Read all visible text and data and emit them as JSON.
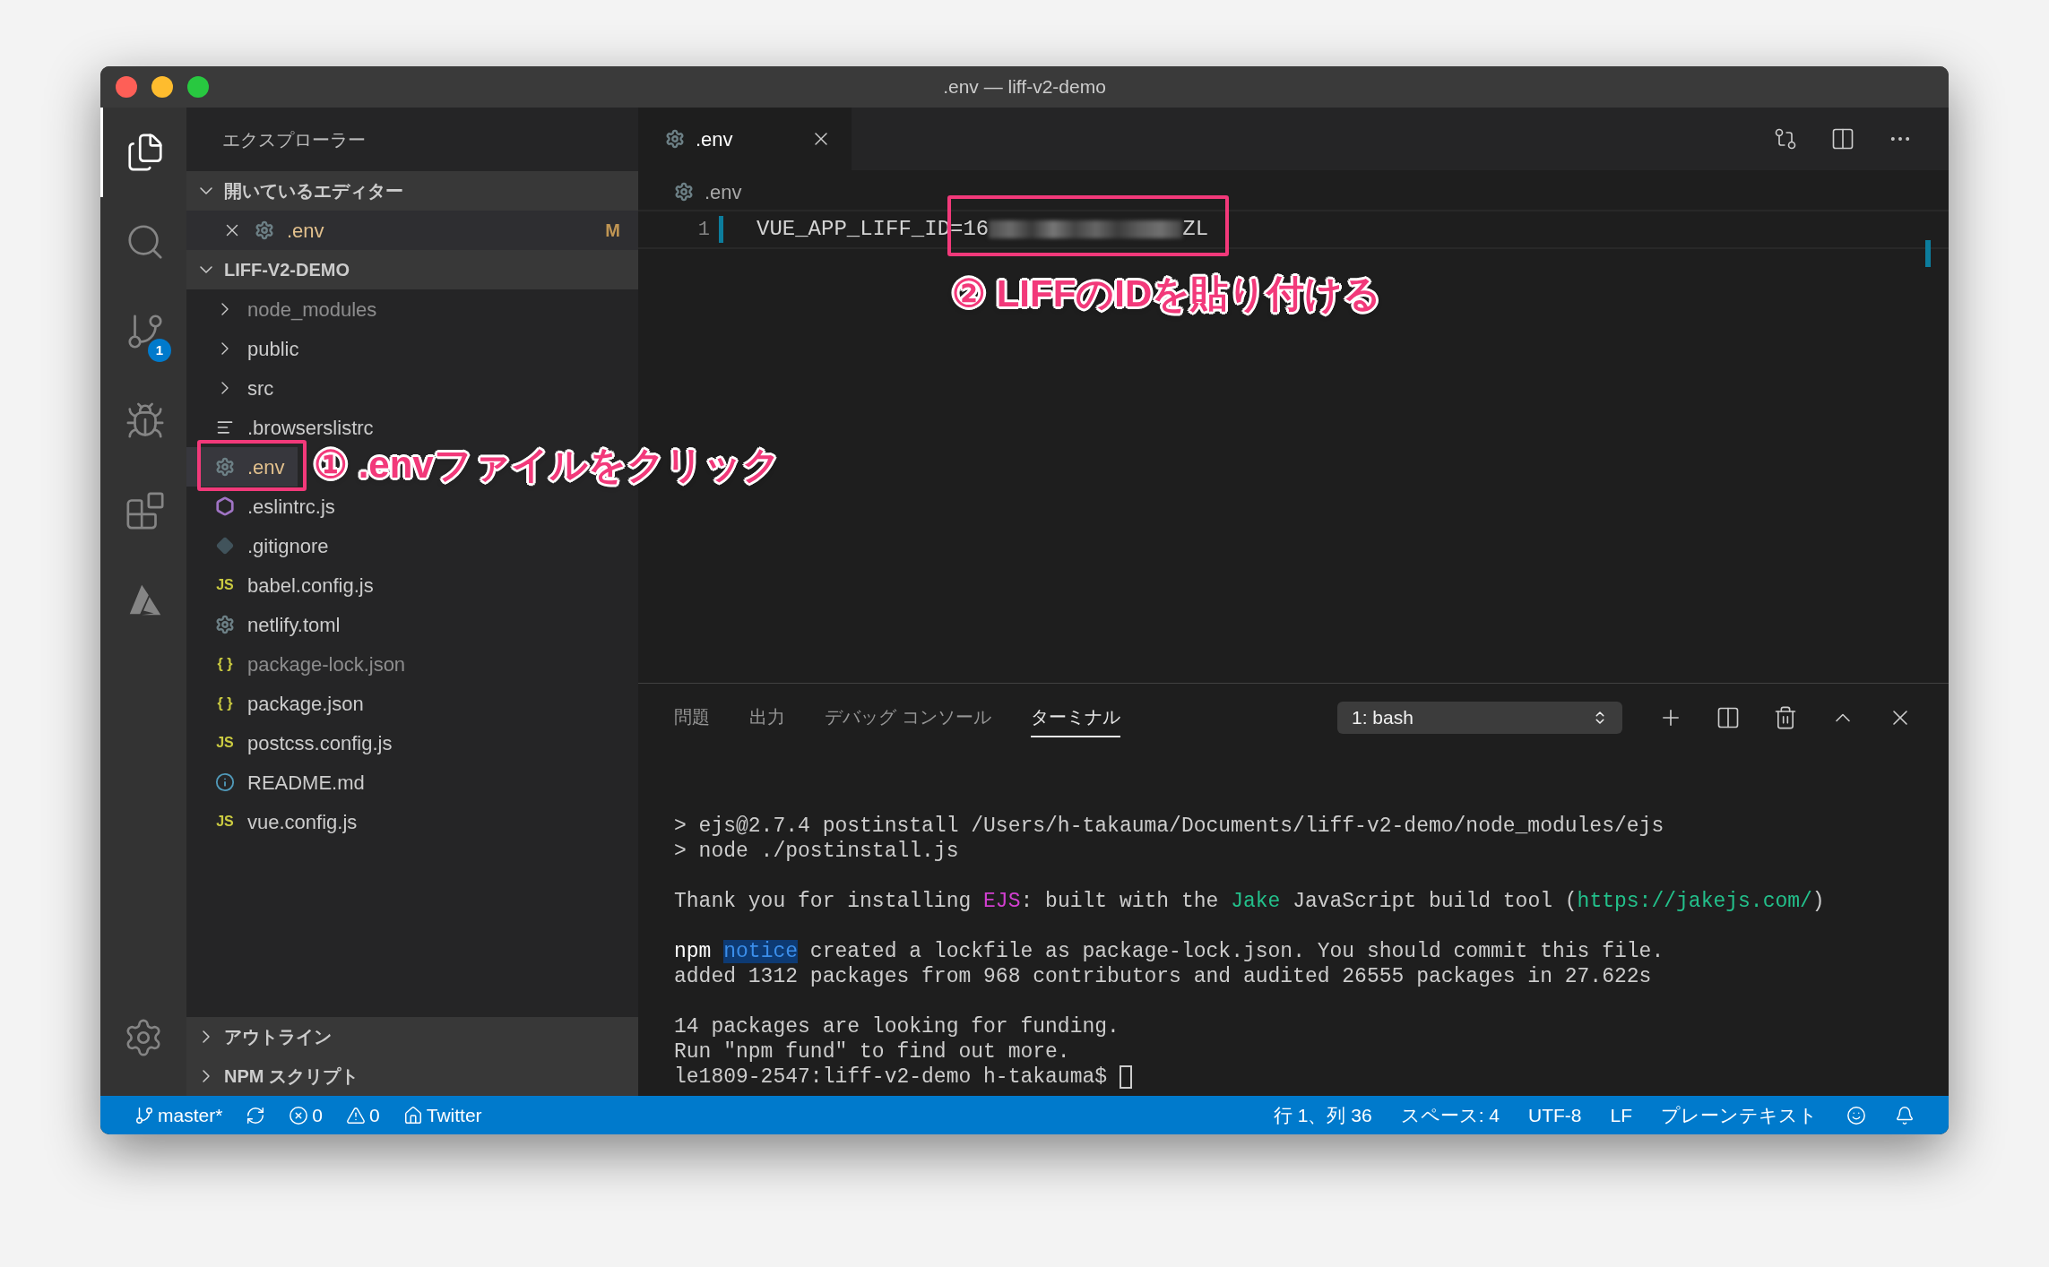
{
  "window": {
    "title": ".env — liff-v2-demo"
  },
  "activity_bar": {
    "items": [
      {
        "kind": "files",
        "selected": true
      },
      {
        "kind": "search",
        "selected": false
      },
      {
        "kind": "source-control",
        "selected": false,
        "badge": "1"
      },
      {
        "kind": "debug",
        "selected": false
      },
      {
        "kind": "extensions",
        "selected": false
      },
      {
        "kind": "azure",
        "selected": false
      }
    ],
    "bottom_items": [
      {
        "kind": "settings"
      }
    ]
  },
  "sidebar": {
    "title": "エクスプローラー",
    "open_editors": {
      "title": "開いているエディター",
      "expanded": true,
      "items": [
        {
          "name": ".env",
          "kind": "config",
          "modified": true,
          "badge": "M"
        }
      ]
    },
    "project": {
      "title": "LIFF-V2-DEMO",
      "expanded": true,
      "items": [
        {
          "name": "node_modules",
          "kind": "folder",
          "expanded": false,
          "dimmed": true,
          "modified": false,
          "selected": false
        },
        {
          "name": "public",
          "kind": "folder",
          "expanded": false,
          "dimmed": false,
          "modified": false,
          "selected": false
        },
        {
          "name": "src",
          "kind": "folder",
          "expanded": false,
          "dimmed": false,
          "modified": false,
          "selected": false
        },
        {
          "name": ".browserslistrc",
          "kind": "text",
          "dimmed": false,
          "modified": false,
          "selected": false
        },
        {
          "name": ".env",
          "kind": "config",
          "dimmed": false,
          "modified": true,
          "selected": true
        },
        {
          "name": ".eslintrc.js",
          "kind": "eslint",
          "dimmed": false,
          "modified": false,
          "selected": false
        },
        {
          "name": ".gitignore",
          "kind": "git",
          "dimmed": false,
          "modified": false,
          "selected": false
        },
        {
          "name": "babel.config.js",
          "kind": "script",
          "glyph": "JS",
          "dimmed": false,
          "modified": false,
          "selected": false
        },
        {
          "name": "netlify.toml",
          "kind": "config",
          "dimmed": false,
          "modified": false,
          "selected": false
        },
        {
          "name": "package-lock.json",
          "kind": "json",
          "glyph": "{ }",
          "dimmed": true,
          "modified": false,
          "selected": false
        },
        {
          "name": "package.json",
          "kind": "json",
          "glyph": "{ }",
          "dimmed": false,
          "modified": false,
          "selected": false
        },
        {
          "name": "postcss.config.js",
          "kind": "script",
          "glyph": "JS",
          "dimmed": false,
          "modified": false,
          "selected": false
        },
        {
          "name": "README.md",
          "kind": "readme",
          "dimmed": false,
          "modified": false,
          "selected": false
        },
        {
          "name": "vue.config.js",
          "kind": "script",
          "glyph": "JS",
          "dimmed": false,
          "modified": false,
          "selected": false
        }
      ]
    },
    "collapsed_sections": [
      {
        "title": "アウトライン",
        "expanded": false
      },
      {
        "title": "NPM スクリプト",
        "expanded": false
      }
    ]
  },
  "editor": {
    "tabs": [
      {
        "name": ".env",
        "kind": "config",
        "selected": true
      }
    ],
    "breadcrumb": ".env",
    "lines": [
      {
        "number": "1",
        "text": "VUE_APP_LIFF_ID=16",
        "redacted": true,
        "text_after": "ZL"
      }
    ]
  },
  "panel": {
    "tabs": [
      {
        "label": "問題",
        "selected": false
      },
      {
        "label": "出力",
        "selected": false
      },
      {
        "label": "デバッグ コンソール",
        "selected": false
      },
      {
        "label": "ターミナル",
        "selected": true
      }
    ],
    "terminal_select": "1: bash",
    "terminal_blocks": [
      [
        {
          "segments": [
            {
              "kind": "plain",
              "text": "> ejs@2.7.4 postinstall /Users/h-takauma/Documents/liff-v2-demo/node_modules/ejs"
            }
          ]
        },
        {
          "segments": [
            {
              "kind": "plain",
              "text": "> node ./postinstall.js"
            }
          ]
        }
      ],
      [
        {
          "segments": [
            {
              "kind": "plain",
              "text": "Thank you for installing "
            },
            {
              "kind": "accent",
              "text": "EJS",
              "color": "#d23fd0"
            },
            {
              "kind": "plain",
              "text": ": built with the "
            },
            {
              "kind": "accent",
              "text": "Jake",
              "color": "#23c08b"
            },
            {
              "kind": "plain",
              "text": " JavaScript build tool ("
            },
            {
              "kind": "accent",
              "text": "https://jakejs.com/",
              "color": "#23c08b"
            },
            {
              "kind": "plain",
              "text": ")"
            }
          ]
        }
      ],
      [
        {
          "segments": [
            {
              "kind": "bright",
              "text": "npm "
            },
            {
              "kind": "badge",
              "text": "notice"
            },
            {
              "kind": "plain",
              "text": " created a lockfile as package-lock.json. You should commit this file."
            }
          ]
        },
        {
          "segments": [
            {
              "kind": "plain",
              "text": "added 1312 packages from 968 contributors and audited 26555 packages in 27.622s"
            }
          ]
        }
      ],
      [
        {
          "segments": [
            {
              "kind": "plain",
              "text": "14 packages are looking for funding."
            }
          ]
        },
        {
          "segments": [
            {
              "kind": "plain",
              "text": "Run \"npm fund\" to find out more."
            }
          ]
        },
        {
          "segments": [
            {
              "kind": "plain",
              "text": "le1809-2547:liff-v2-demo h-takauma$ "
            }
          ],
          "cursor": true
        }
      ]
    ]
  },
  "status_bar": {
    "left": [
      {
        "kind": "branch",
        "text": "master*"
      },
      {
        "kind": "sync"
      },
      {
        "kind": "error",
        "text": "0"
      },
      {
        "kind": "warning",
        "text": "0"
      },
      {
        "kind": "home",
        "text": "Twitter"
      }
    ],
    "right": [
      {
        "kind": "plain",
        "text": "行 1、列 36"
      },
      {
        "kind": "plain",
        "text": "スペース: 4"
      },
      {
        "kind": "plain",
        "text": "UTF-8"
      },
      {
        "kind": "plain",
        "text": "LF"
      },
      {
        "kind": "plain",
        "text": "プレーンテキスト"
      },
      {
        "kind": "smiley"
      },
      {
        "kind": "bell"
      }
    ]
  },
  "annotations": [
    {
      "text": "① .envファイルをクリック"
    },
    {
      "text": "② LIFFのIDを貼り付ける"
    }
  ]
}
